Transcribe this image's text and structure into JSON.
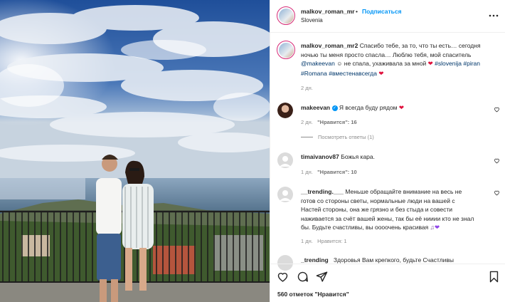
{
  "header": {
    "username": "malkov_roman_mr",
    "separator": "•",
    "follow_label": "Подписаться",
    "location": "Slovenia",
    "more_icon": "more-dots-icon"
  },
  "caption": {
    "username": "malkov_roman_mr2",
    "line1": "Спасибо тебе, за то, что ты есть… сегодня",
    "line2": "ночью ты меня просто спасла… Люблю тебя, мой спаситель",
    "mention": "@makeevan",
    "line3_mid": " не спала, ухаживала за мной ",
    "tag1": "#slovenija",
    "tag2": "#piran",
    "tag3": "#Romana",
    "tag4": "#вместенавсегда",
    "time": "2 дн."
  },
  "comments": [
    {
      "username": "makeevan",
      "text": "Я всегда буду рядом",
      "time": "2 дн.",
      "likes": "\"Нравится\": 16",
      "replies": "Посмотреть ответы (1)"
    },
    {
      "username": "timaivanov87",
      "text": "Божья кара.",
      "time": "1 дн.",
      "likes": "\"Нравится\": 10"
    },
    {
      "username": "__trending.___",
      "line1": "Меньше обращайте внимание на весь не",
      "line2": "готов со стороны светы, нормальные люди на вашей с",
      "line3": "Настей стороны, она же грязно и без стыда и совести",
      "line4": "наживается за счёт вашей жены, так бы её нииии кто не знал",
      "line5": "бы. Будьте счастливы, вы оооочень красивая",
      "time": "1 дн.",
      "likes": "Нравится: 1"
    },
    {
      "username": "_trending",
      "text": "Здоровья Вам крепкого, будьте Счастливы"
    }
  ],
  "footer": {
    "likes": "560 отметок \"Нравится\"",
    "icons": [
      "heart-outline-icon",
      "comment-icon",
      "share-icon",
      "bookmark-icon"
    ]
  },
  "colors": {
    "accent": "#0095f6",
    "heart": "#e0103c",
    "hashtag": "#00376b",
    "muted": "#8e8e8e"
  }
}
